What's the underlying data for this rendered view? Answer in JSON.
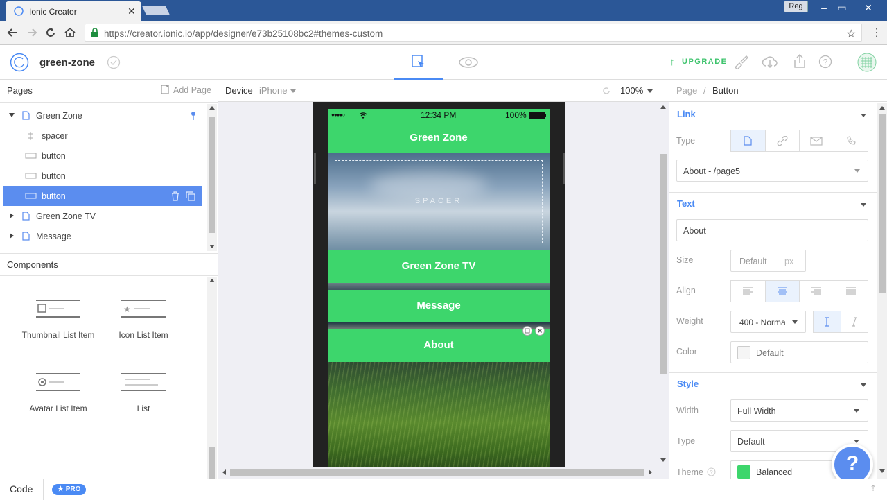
{
  "browser": {
    "tab_title": "Ionic Creator",
    "url": "https://creator.ionic.io/app/designer/e73b25108bc2#themes-custom",
    "user_badge": "Reg"
  },
  "app": {
    "project_name": "green-zone",
    "upgrade_label": "UPGRADE"
  },
  "pages_panel": {
    "title": "Pages",
    "add_page": "Add Page",
    "tree": [
      {
        "label": "Green Zone",
        "type": "page",
        "expanded": true
      },
      {
        "label": "spacer",
        "type": "spacer"
      },
      {
        "label": "button",
        "type": "button"
      },
      {
        "label": "button",
        "type": "button"
      },
      {
        "label": "button",
        "type": "button",
        "selected": true
      },
      {
        "label": "Green Zone TV",
        "type": "page"
      },
      {
        "label": "Message",
        "type": "page"
      }
    ]
  },
  "components_panel": {
    "title": "Components",
    "items": [
      {
        "label": "Thumbnail List Item"
      },
      {
        "label": "Icon List Item"
      },
      {
        "label": "Avatar List Item"
      },
      {
        "label": "List"
      }
    ]
  },
  "canvas": {
    "device_label": "Device",
    "device_value": "iPhone",
    "zoom": "100%",
    "phone": {
      "time": "12:34 PM",
      "battery": "100%",
      "header_title": "Green Zone",
      "spacer_text": "SPACER",
      "buttons": [
        "Green Zone TV",
        "Message",
        "About"
      ]
    }
  },
  "props": {
    "breadcrumb_parent": "Page",
    "breadcrumb_sep": "/",
    "breadcrumb_current": "Button",
    "link_section": "Link",
    "type_label": "Type",
    "link_target": "About - /page5",
    "text_section": "Text",
    "text_value": "About",
    "size_label": "Size",
    "size_placeholder": "Default",
    "size_unit": "px",
    "align_label": "Align",
    "weight_label": "Weight",
    "weight_value": "400 - Norma",
    "color_label": "Color",
    "color_value": "Default",
    "style_section": "Style",
    "width_label": "Width",
    "width_value": "Full Width",
    "style_type_label": "Type",
    "style_type_value": "Default",
    "theme_label": "Theme",
    "theme_value": "Balanced",
    "theme_color": "#3dd66c"
  },
  "footer": {
    "code_tab": "Code",
    "pro_badge": "★ PRO"
  },
  "colors": {
    "accent": "#4a8af4",
    "selection": "#5b8def",
    "button_green": "#3dd66c",
    "help_fab": "#5b8def"
  }
}
